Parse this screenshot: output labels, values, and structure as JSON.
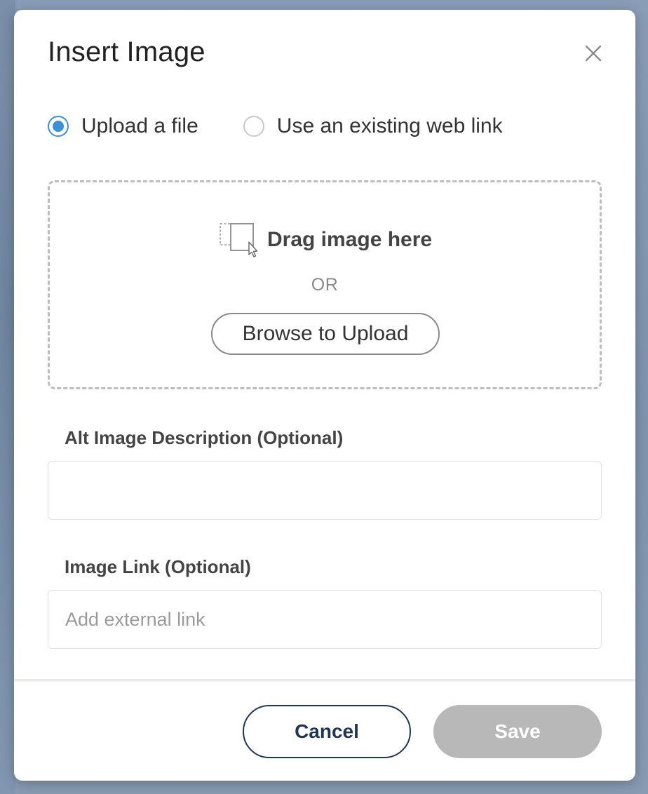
{
  "dialog": {
    "title": "Insert Image",
    "close_icon": "close-icon"
  },
  "source_options": [
    {
      "label": "Upload a file",
      "checked": true
    },
    {
      "label": "Use an existing web link",
      "checked": false
    }
  ],
  "dropzone": {
    "icon": "drag-drop-icon",
    "drag_text": "Drag image here",
    "or_text": "OR",
    "browse_label": "Browse to Upload"
  },
  "alt_field": {
    "label": "Alt Image Description (Optional)",
    "value": "",
    "placeholder": ""
  },
  "link_field": {
    "label": "Image Link (Optional)",
    "value": "",
    "placeholder": "Add external link"
  },
  "footer": {
    "cancel_label": "Cancel",
    "save_label": "Save"
  },
  "colors": {
    "accent": "#3d8fd6",
    "cancel_border": "#1f3554",
    "save_disabled": "#b8b8b8"
  }
}
